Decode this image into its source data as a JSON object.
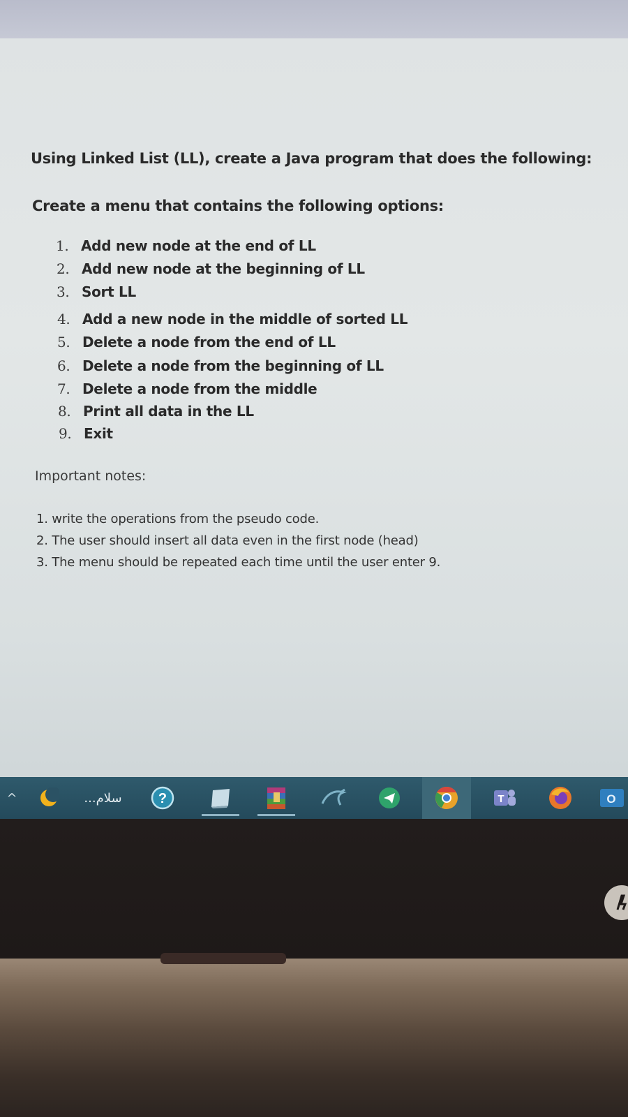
{
  "document": {
    "title": "Using Linked List (LL), create a Java program that does the following:",
    "subtitle": "Create a menu that contains the following options:",
    "options": [
      {
        "num": "1.",
        "text": "Add new node at the end of LL"
      },
      {
        "num": "2.",
        "text": "Add new node at the beginning of LL"
      },
      {
        "num": "3.",
        "text": "Sort LL"
      },
      {
        "num": "4.",
        "text": "Add a new node in the middle of sorted LL"
      },
      {
        "num": "5.",
        "text": "Delete a node from the end of LL"
      },
      {
        "num": "6.",
        "text": "Delete a node from the beginning of LL"
      },
      {
        "num": "7.",
        "text": "Delete a node from the middle"
      },
      {
        "num": "8.",
        "text": "Print all data in the LL"
      },
      {
        "num": "9.",
        "text": "Exit"
      }
    ],
    "notes_heading": "Important notes:",
    "notes": [
      "1. write the operations from the pseudo code.",
      "2. The user should insert all data even in the first node (head)",
      "3. The menu should be repeated each time until the user enter 9."
    ]
  },
  "taskbar": {
    "chevron": "^",
    "search_text": "...سلام",
    "icons": [
      "chevron-up-icon",
      "moon-icon",
      "help-icon",
      "notepad-icon",
      "winrar-icon",
      "mysql-icon",
      "telegram-icon",
      "chrome-icon",
      "teams-icon",
      "firefox-icon",
      "outlook-icon"
    ],
    "teams_letter": "T",
    "outlook_letter": "O",
    "help_glyph": "?"
  },
  "colors": {
    "screen_bg": "#e1e5e5",
    "taskbar": "#2b5264",
    "text": "#2a2a2a"
  }
}
